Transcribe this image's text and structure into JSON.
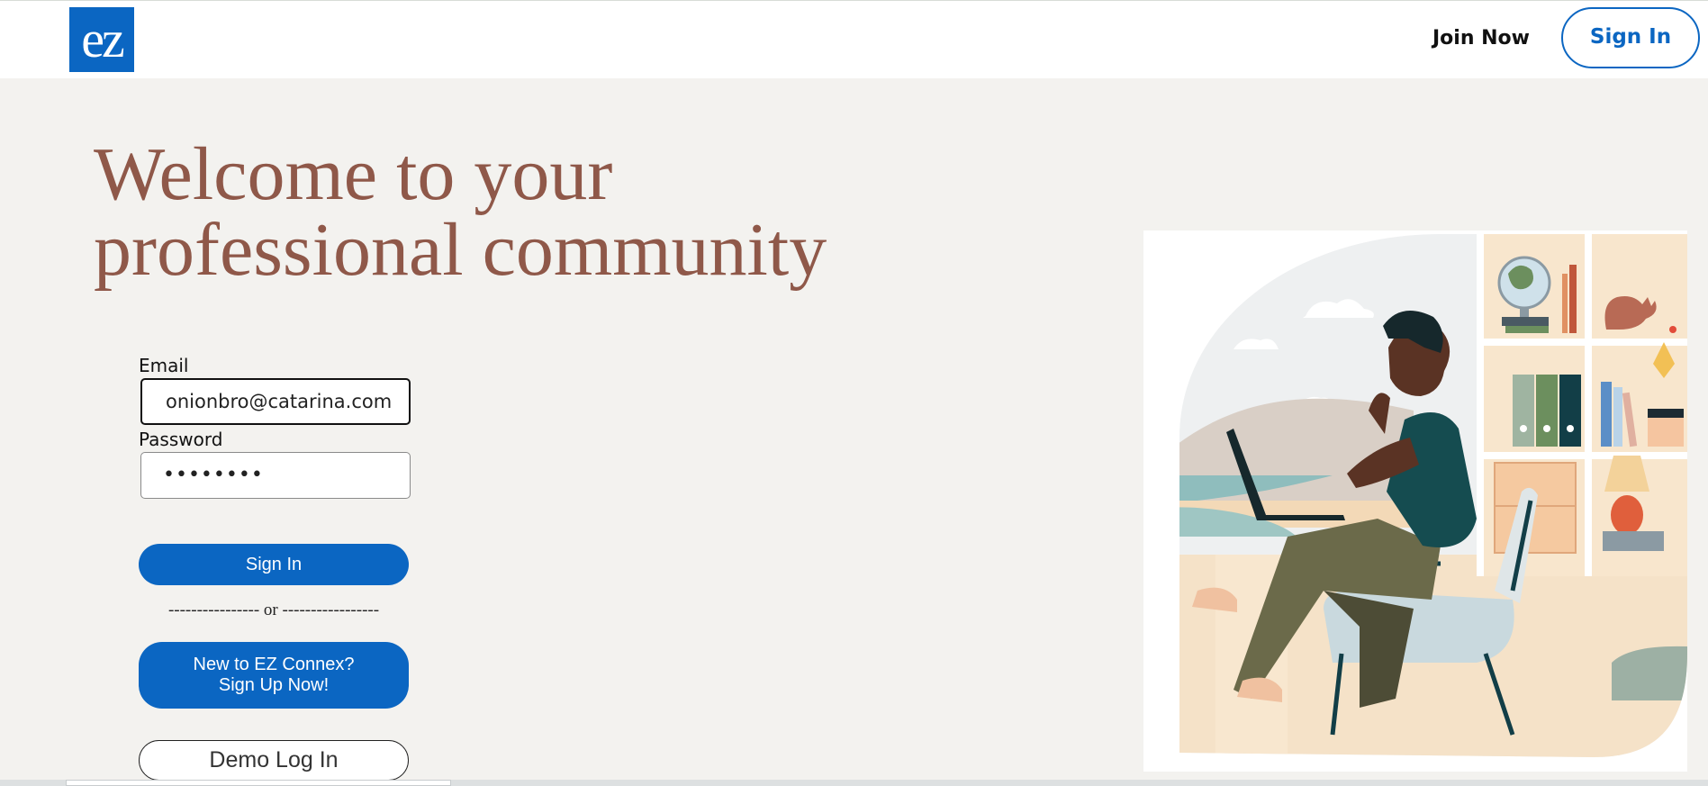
{
  "header": {
    "logo_text": "ez",
    "join_now_label": "Join Now",
    "sign_in_label": "Sign In"
  },
  "hero": {
    "headline_line1": "Welcome to your",
    "headline_line2": "professional community"
  },
  "login_form": {
    "email_label": "Email",
    "email_value": "onionbro@catarina.com",
    "password_label": "Password",
    "password_value": "••••••••",
    "sign_in_button": "Sign In",
    "or_divider": "---------------- or -----------------",
    "signup_button_line1": "New to EZ Connex?",
    "signup_button_line2": "Sign Up Now!",
    "demo_button": "Demo Log In"
  },
  "colors": {
    "brand_blue": "#0b66c2",
    "headline_brown": "#8f5849",
    "page_background": "#f3f2ef"
  },
  "illustration": {
    "icons": [
      "globe-icon",
      "cat-icon",
      "lamp-icon",
      "laptop-icon",
      "chair-icon",
      "person-icon"
    ]
  }
}
